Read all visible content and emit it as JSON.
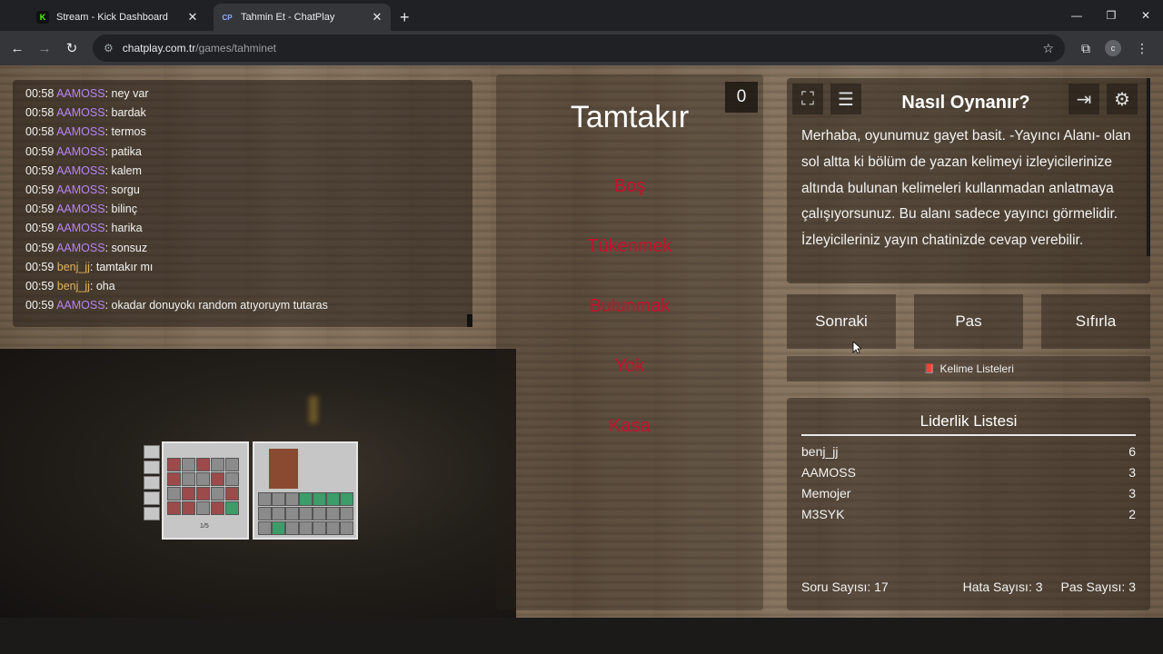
{
  "browser": {
    "tabs": [
      {
        "favicon": "K",
        "title": "Stream - Kick Dashboard",
        "active": false
      },
      {
        "favicon": "CP",
        "title": "Tahmin Et - ChatPlay",
        "active": true
      }
    ],
    "new_tab": "+",
    "url_host": "chatplay.com.tr",
    "url_path": "/games/tahminet",
    "profile_initial": "c"
  },
  "chat": {
    "messages": [
      {
        "time": "00:58",
        "user": "AAMOSS",
        "text": ": ney var"
      },
      {
        "time": "00:58",
        "user": "AAMOSS",
        "text": ": bardak"
      },
      {
        "time": "00:58",
        "user": "AAMOSS",
        "text": ": termos"
      },
      {
        "time": "00:59",
        "user": "AAMOSS",
        "text": ": patika"
      },
      {
        "time": "00:59",
        "user": "AAMOSS",
        "text": ": kalem"
      },
      {
        "time": "00:59",
        "user": "AAMOSS",
        "text": ": sorgu"
      },
      {
        "time": "00:59",
        "user": "AAMOSS",
        "text": ": bilinç"
      },
      {
        "time": "00:59",
        "user": "AAMOSS",
        "text": ": harika"
      },
      {
        "time": "00:59",
        "user": "AAMOSS",
        "text": ": sonsuz"
      },
      {
        "time": "00:59",
        "user": "benj_jj",
        "text": ": tamtakır mı"
      },
      {
        "time": "00:59",
        "user": "benj_jj",
        "text": ": oha"
      },
      {
        "time": "00:59",
        "user": "AAMOSS",
        "text": ": okadar donuyokı random atıyoruym tutaras"
      }
    ]
  },
  "game": {
    "score": "0",
    "word": "Tamtakır",
    "taboo_words": [
      "Boş",
      "Tükenmek",
      "Bulunmak",
      "Yok",
      "Kasa"
    ]
  },
  "howto": {
    "title": "Nasıl Oynanır?",
    "text": "Merhaba, oyunumuz gayet basit. -Yayıncı Alanı- olan sol altta ki bölüm de yazan kelimeyi izleyicilerinize altında bulunan kelimeleri kullanmadan anlatmaya çalışıyorsunuz. Bu alanı sadece yayıncı görmelidir. İzleyicileriniz yayın chatinizde cevap verebilir."
  },
  "controls": {
    "next": "Sonraki",
    "pass": "Pas",
    "reset": "Sıfırla",
    "word_lists": "Kelime Listeleri"
  },
  "leaderboard": {
    "title": "Liderlik Listesi",
    "rows": [
      {
        "name": "benj_jj",
        "score": "6"
      },
      {
        "name": "AAMOSS",
        "score": "3"
      },
      {
        "name": "Memojer",
        "score": "3"
      },
      {
        "name": "M3SYK",
        "score": "2"
      }
    ]
  },
  "stats": {
    "questions": "Soru Sayısı: 17",
    "errors": "Hata Sayısı: 3",
    "passes": "Pas Sayısı: 3"
  },
  "inventory": {
    "page": "1/5"
  }
}
